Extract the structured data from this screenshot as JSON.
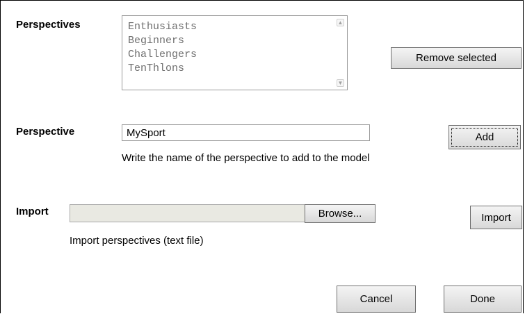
{
  "perspectives": {
    "label": "Perspectives",
    "items": [
      "Enthusiasts",
      "Beginners",
      "Challengers",
      "TenThlons"
    ],
    "remove_button": "Remove selected"
  },
  "perspective": {
    "label": "Perspective",
    "value": "MySport",
    "add_button": "Add",
    "help": "Write the name of the perspective to add to the model"
  },
  "import": {
    "label": "Import",
    "browse_button": "Browse...",
    "import_button": "Import",
    "help": "Import perspectives (text file)"
  },
  "footer": {
    "cancel_button": "Cancel",
    "done_button": "Done"
  }
}
